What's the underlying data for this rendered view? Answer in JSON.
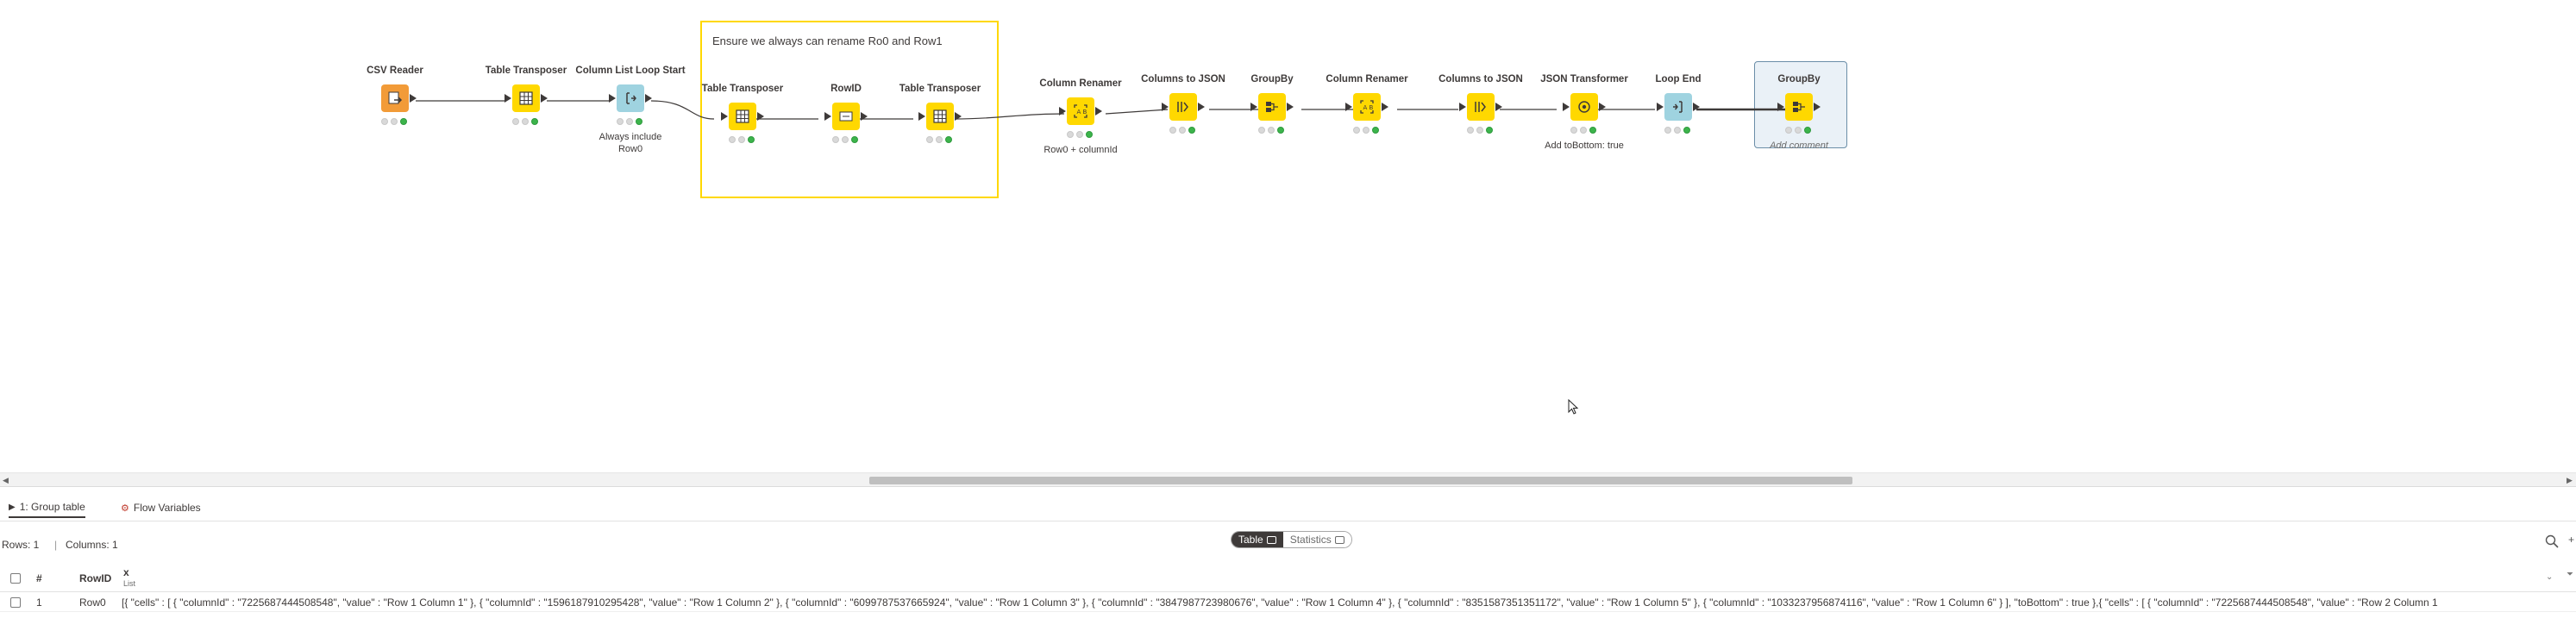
{
  "canvas": {
    "annotation": {
      "text": "Ensure we always can rename Ro0 and Row1",
      "color": "#ffd800"
    },
    "nodes": [
      {
        "id": "csv-reader",
        "title": "CSV Reader",
        "icon": "csv-reader-icon",
        "kind": "source",
        "comment": ""
      },
      {
        "id": "table-transposer-1",
        "title": "Table Transposer",
        "icon": "grid-icon",
        "kind": "manip",
        "comment": ""
      },
      {
        "id": "column-list-loop-start",
        "title": "Column List Loop Start",
        "icon": "loop-start-icon",
        "kind": "loop",
        "comment": "Always include\nRow0"
      },
      {
        "id": "table-transposer-2",
        "title": "Table Transposer",
        "icon": "grid-icon",
        "kind": "manip",
        "comment": ""
      },
      {
        "id": "rowid",
        "title": "RowID",
        "icon": "rowid-icon",
        "kind": "manip",
        "comment": ""
      },
      {
        "id": "table-transposer-3",
        "title": "Table Transposer",
        "icon": "grid-icon",
        "kind": "manip",
        "comment": ""
      },
      {
        "id": "column-renamer-1",
        "title": "Column Renamer",
        "icon": "rename-icon",
        "kind": "manip",
        "comment": "Row0 + columnId"
      },
      {
        "id": "columns-to-json-1",
        "title": "Columns to JSON",
        "icon": "columns-to-json-icon",
        "kind": "manip",
        "comment": ""
      },
      {
        "id": "groupby-1",
        "title": "GroupBy",
        "icon": "groupby-icon",
        "kind": "manip",
        "comment": ""
      },
      {
        "id": "column-renamer-2",
        "title": "Column Renamer",
        "icon": "rename-icon",
        "kind": "manip",
        "comment": ""
      },
      {
        "id": "columns-to-json-2",
        "title": "Columns to JSON",
        "icon": "columns-to-json-icon",
        "kind": "manip",
        "comment": ""
      },
      {
        "id": "json-transformer",
        "title": "JSON Transformer",
        "icon": "json-transformer-icon",
        "kind": "manip",
        "comment": "Add toBottom: true"
      },
      {
        "id": "loop-end",
        "title": "Loop End",
        "icon": "loop-end-icon",
        "kind": "loop",
        "comment": ""
      },
      {
        "id": "groupby-2",
        "title": "GroupBy",
        "icon": "groupby-icon",
        "kind": "manip",
        "comment": "Add comment",
        "selected": true
      }
    ]
  },
  "panel": {
    "tabs": [
      {
        "label": "1: Group table",
        "icon": "play-icon",
        "active": true
      },
      {
        "label": "Flow Variables",
        "icon": "flow-variable-icon",
        "active": false
      }
    ],
    "rows_label": "Rows: 1",
    "columns_label": "Columns: 1",
    "view_toggle": {
      "table": "Table",
      "statistics": "Statistics",
      "selected": "Table"
    },
    "table": {
      "headers": {
        "index": "#",
        "rowid": "RowID",
        "col": "x",
        "col_type": "List"
      },
      "rows": [
        {
          "index": "1",
          "rowid": "Row0",
          "value": "[{ \"cells\" : [ { \"columnId\" : \"7225687444508548\", \"value\" : \"Row 1 Column 1\" }, { \"columnId\" : \"1596187910295428\", \"value\" : \"Row 1 Column 2\" }, { \"columnId\" : \"6099787537665924\", \"value\" : \"Row 1 Column 3\" }, { \"columnId\" : \"3847987723980676\", \"value\" : \"Row 1 Column 4\" }, { \"columnId\" : \"8351587351351172\", \"value\" : \"Row 1 Column 5\" }, { \"columnId\" : \"1033237956874116\", \"value\" : \"Row 1 Column 6\" } ], \"toBottom\" : true },{ \"cells\" : [ { \"columnId\" : \"7225687444508548\", \"value\" : \"Row 2 Column 1"
        }
      ]
    }
  },
  "colors": {
    "source": "#f29b38",
    "manip": "#ffd800",
    "loop": "#9fd3e0",
    "selected": "#eaf1f7",
    "port_ok": "#3cb44b"
  }
}
